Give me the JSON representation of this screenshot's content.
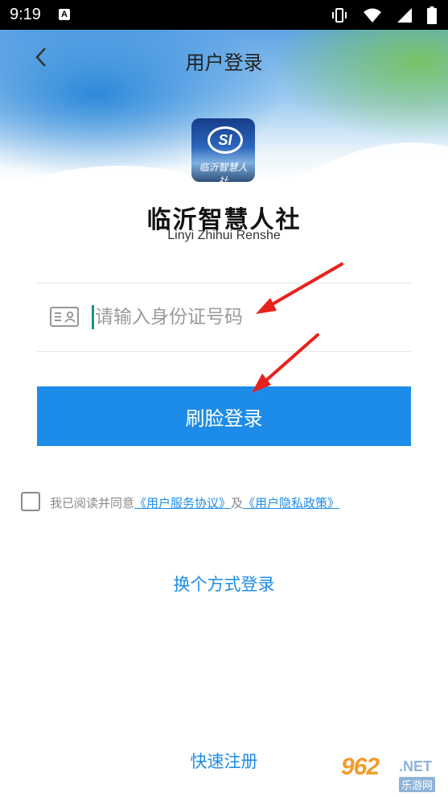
{
  "status_bar": {
    "time": "9:19",
    "notification_icon": "A",
    "icons": [
      "vibrate-icon",
      "wifi-icon",
      "signal-icon",
      "battery-icon"
    ]
  },
  "header": {
    "title": "用户登录",
    "back_icon": "chevron-left-icon"
  },
  "app": {
    "logo_text": "SI",
    "logo_script": "临沂智慧人社",
    "name_cn": "临沂智慧人社",
    "name_en": "Linyi Zhihui Renshe"
  },
  "login_form": {
    "id_placeholder": "请输入身份证号码",
    "id_value": "",
    "face_login_label": "刷脸登录"
  },
  "agreement": {
    "prefix": "我已阅读并同意",
    "service_link": "《用户服务协议》",
    "connector": "及",
    "privacy_link": "《用户隐私政策》",
    "checked": false
  },
  "links": {
    "switch_login": "换个方式登录",
    "quick_register": "快速注册"
  },
  "watermark": {
    "number": "962",
    "suffix": ".NET",
    "cn": "乐游网"
  },
  "colors": {
    "accent": "#1d8ce8",
    "annotation_arrow": "#e8211c"
  }
}
